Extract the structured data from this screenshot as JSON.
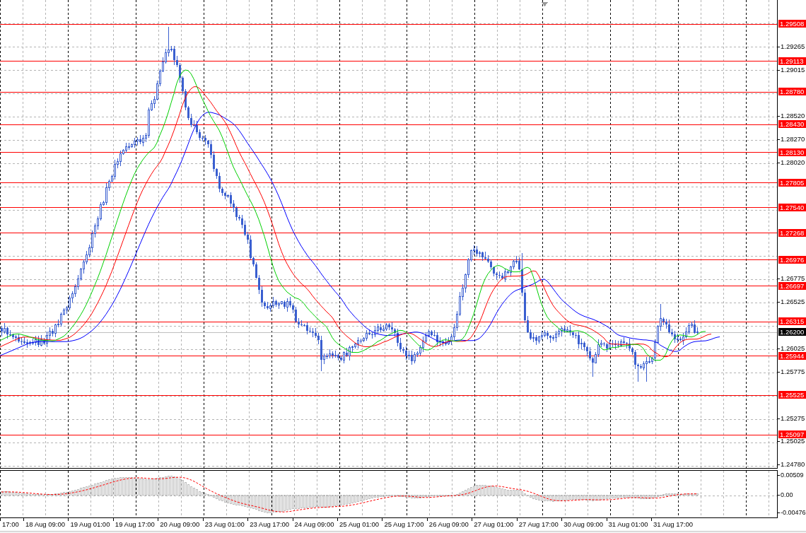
{
  "price_chart": {
    "axis_ticks": [
      "1.29265",
      "1.29015",
      "1.28520",
      "1.28270",
      "1.28020",
      "1.26775",
      "1.26525",
      "1.26025",
      "1.25775",
      "1.25275",
      "1.25025",
      "1.24780"
    ],
    "levels": [
      "1.29508",
      "1.29113",
      "1.28780",
      "1.28430",
      "1.28130",
      "1.27805",
      "1.27540",
      "1.27268",
      "1.26976",
      "1.26697",
      "1.26315",
      "1.25944",
      "1.25525",
      "1.25097"
    ],
    "current_price": {
      "label": "1.26200"
    }
  },
  "indicator": {
    "axis_ticks": [
      "0.00509",
      "0.00",
      "-0.00476"
    ]
  },
  "time_axis": {
    "labels": [
      "17:00",
      "18 Aug 09:00",
      "19 Aug 01:00",
      "19 Aug 17:00",
      "20 Aug 09:00",
      "23 Aug 01:00",
      "23 Aug 17:00",
      "24 Aug 09:00",
      "25 Aug 01:00",
      "25 Aug 17:00",
      "26 Aug 09:00",
      "27 Aug 01:00",
      "27 Aug 17:00",
      "30 Aug 09:00",
      "31 Aug 01:00",
      "31 Aug 17:00"
    ]
  }
}
